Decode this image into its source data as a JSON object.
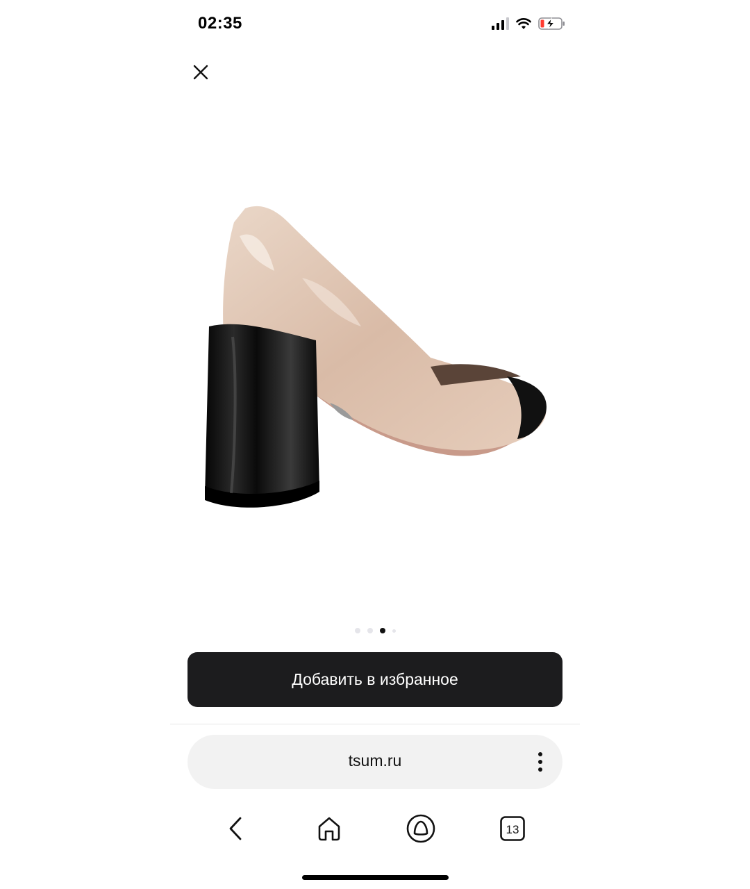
{
  "status_bar": {
    "time": "02:35"
  },
  "gallery": {
    "total": 4,
    "active_index": 2
  },
  "actions": {
    "favorite_label": "Добавить в избранное"
  },
  "browser": {
    "address": "tsum.ru",
    "tabs_count": "13"
  },
  "icons": {
    "close": "close-icon",
    "more": "more-vertical-icon",
    "back": "back-arrow-icon",
    "home": "home-icon",
    "assistant": "assistant-icon",
    "tabs": "tabs-icon"
  },
  "colors": {
    "button_bg": "#1c1c1e",
    "address_bg": "#f2f2f2",
    "battery_low": "#ff3b30"
  }
}
